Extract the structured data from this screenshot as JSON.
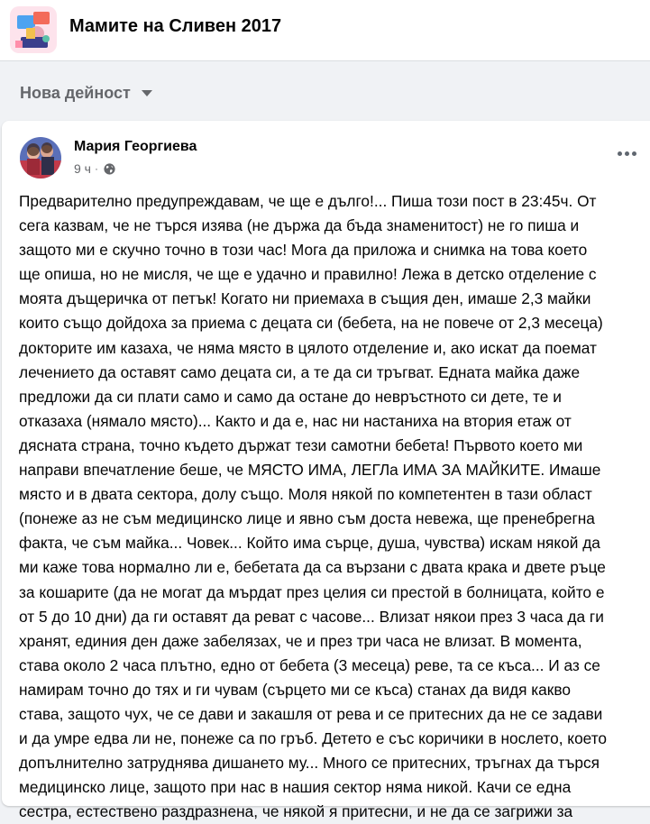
{
  "group": {
    "name": "Мамите на Сливен 2017",
    "avatar_icon": "group-illustration-icon"
  },
  "feed": {
    "sort_label": "Нова дейност"
  },
  "post": {
    "author": "Мария Георгиева",
    "time": "9 ч",
    "separator": "·",
    "audience_icon": "globe-icon",
    "more_icon": "more-options-icon",
    "text_lines": [
      "Предварително предупреждавам, че ще е дълго!... Пиша този пост в 23:45ч. От",
      "сега казвам, че не търся изява (не държа да бъда знаменитост) не го пиша и",
      "защото ми е скучно точно в този час! Мога да приложа и снимка на това което",
      "ще опиша, но не мисля, че ще е удачно и правилно! Лежа в детско отделение с",
      "моята дъщеричка от петък! Когато ни приемаха в същия ден, имаше 2,3 майки",
      "които също дойдоха за приема с децата си (бебета, на не повече от 2,3 месеца)",
      "докторите им казаха, че няма място в цялото отделение и, ако искат да поемат",
      "лечението да оставят само децата си, а те да си тръгват. Едната майка даже",
      "предложи да си плати само и само да остане до невръстното си дете, те и",
      "отказаха (нямало място)... Както и да е, нас ни настаниха на втория етаж от",
      "дясната страна, точно където държат тези самотни бебета! Първото което ми",
      "направи впечатление беше, че МЯСТО ИМА, ЛЕГЛа ИМА ЗА МАЙКИТЕ. Имаше",
      "място и в двата сектора, долу също. Моля някой по компетентен в тази област",
      "(понеже аз не съм медицинско лице и явно съм доста невежа, ще пренебрегна",
      "факта, че съм майка... Човек... Който има сърце, душа, чувства) искам някой да",
      "ми каже това нормално ли е, бебетата да са вързани с двата крака и двете ръце",
      "за кошарите (да не могат да мърдат през целия си престой в болницата, който е",
      "от 5 до 10 дни) да ги оставят да реват с часове... Влизат някои през 3 часа да ги",
      "хранят, единия ден даже забелязах, че и през три часа не влизат. В момента,",
      "става около 2 часа плътно, едно от бебета (3 месеца) реве, та се къса... И аз се",
      "намирам точно до тях и ги чувам (сърцето ми се къса) станах да видя какво",
      "става, защото чух, че се дави и закашля от рева и се притесних да не се задави",
      "и да умре едва ли не, понеже са по гръб. Детето е със коричики в нослето, което",
      "допълнително затруднява дишането му... Много се притесних, тръгнах да търся",
      "медицинско лице, защото при нас в нашия сектор няма никой. Качи се една",
      "сестра, естествено раздразнена, че някой я притесни, и не да се загрижи за"
    ]
  }
}
